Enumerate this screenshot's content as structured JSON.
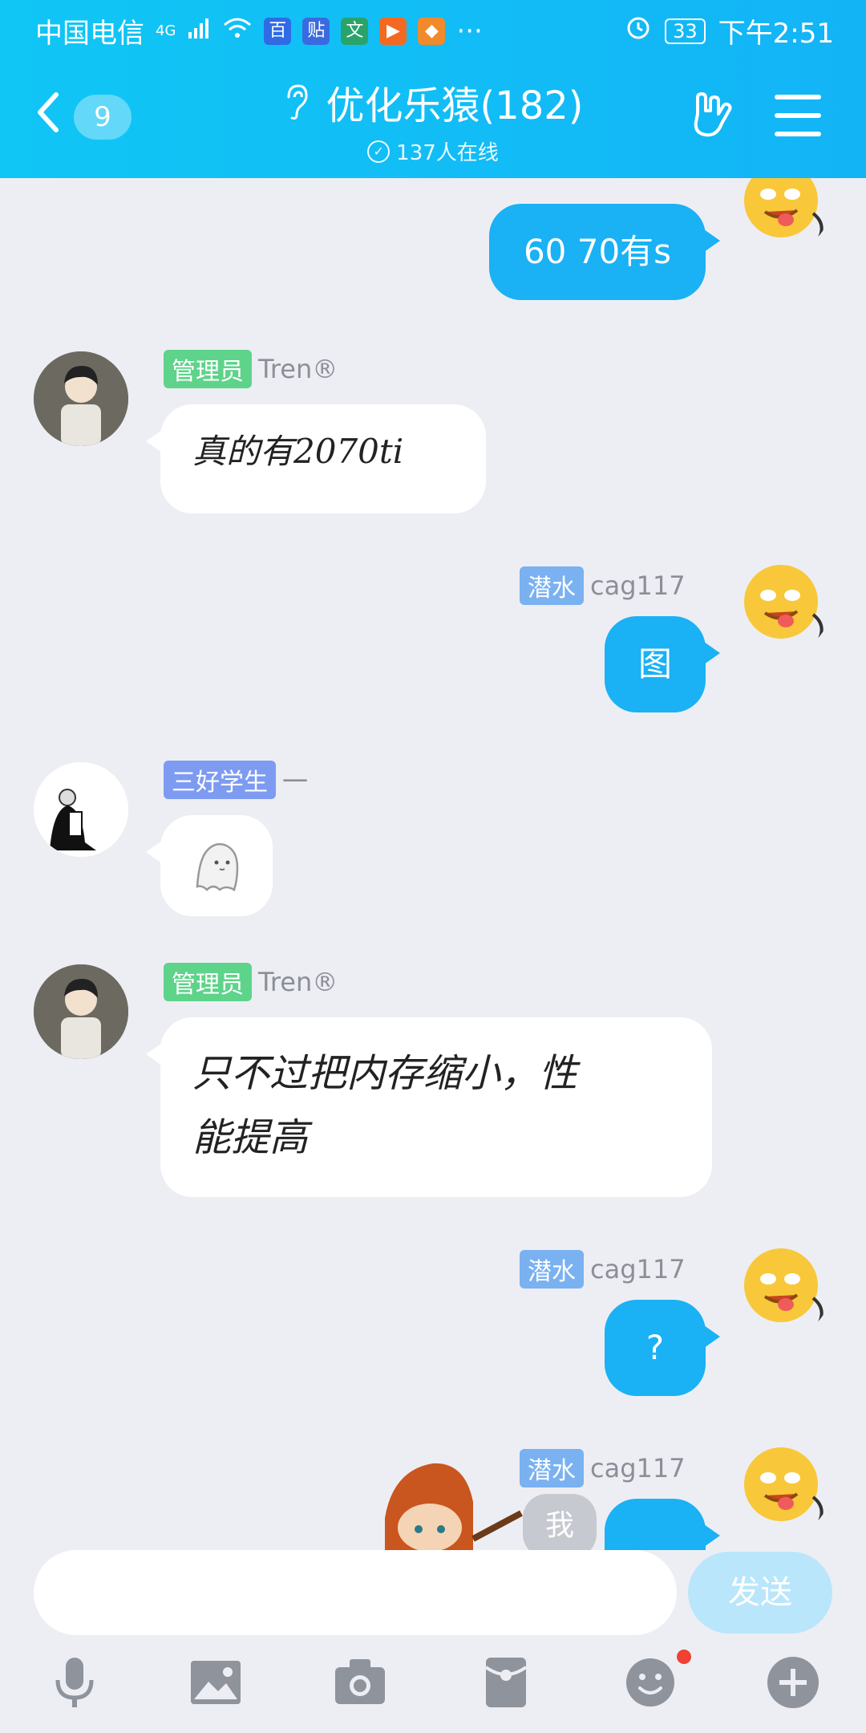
{
  "status_bar": {
    "carrier": "中国电信",
    "network": "4G",
    "battery": "33",
    "time": "下午2:51"
  },
  "header": {
    "back_count": "9",
    "title": "优化乐猿(182)",
    "online": "137人在线"
  },
  "messages": [
    {
      "side": "out",
      "role": "",
      "name": "",
      "text": "60 70有s"
    },
    {
      "side": "in",
      "role": "管理员",
      "name": "Tren®",
      "text": "真的有2070ti"
    },
    {
      "side": "out",
      "role": "潜水",
      "name": "cag117",
      "text": "图"
    },
    {
      "side": "in",
      "role": "三好学生",
      "name": "一",
      "text": ""
    },
    {
      "side": "in",
      "role": "管理员",
      "name": "Tren®",
      "text_line1": "只不过把内存缩小，性",
      "text_line2": "能提高"
    },
    {
      "side": "out",
      "role": "潜水",
      "name": "cag117",
      "text": "?"
    },
    {
      "side": "out",
      "role": "潜水",
      "name": "cag117",
      "text": "我"
    }
  ],
  "input": {
    "send_label": "发送"
  },
  "colors": {
    "header": "#13B4F6",
    "bubble_out": "#1AB1F5",
    "tag_admin": "#5ED38A",
    "tag_rank": "#7E9BF2"
  }
}
